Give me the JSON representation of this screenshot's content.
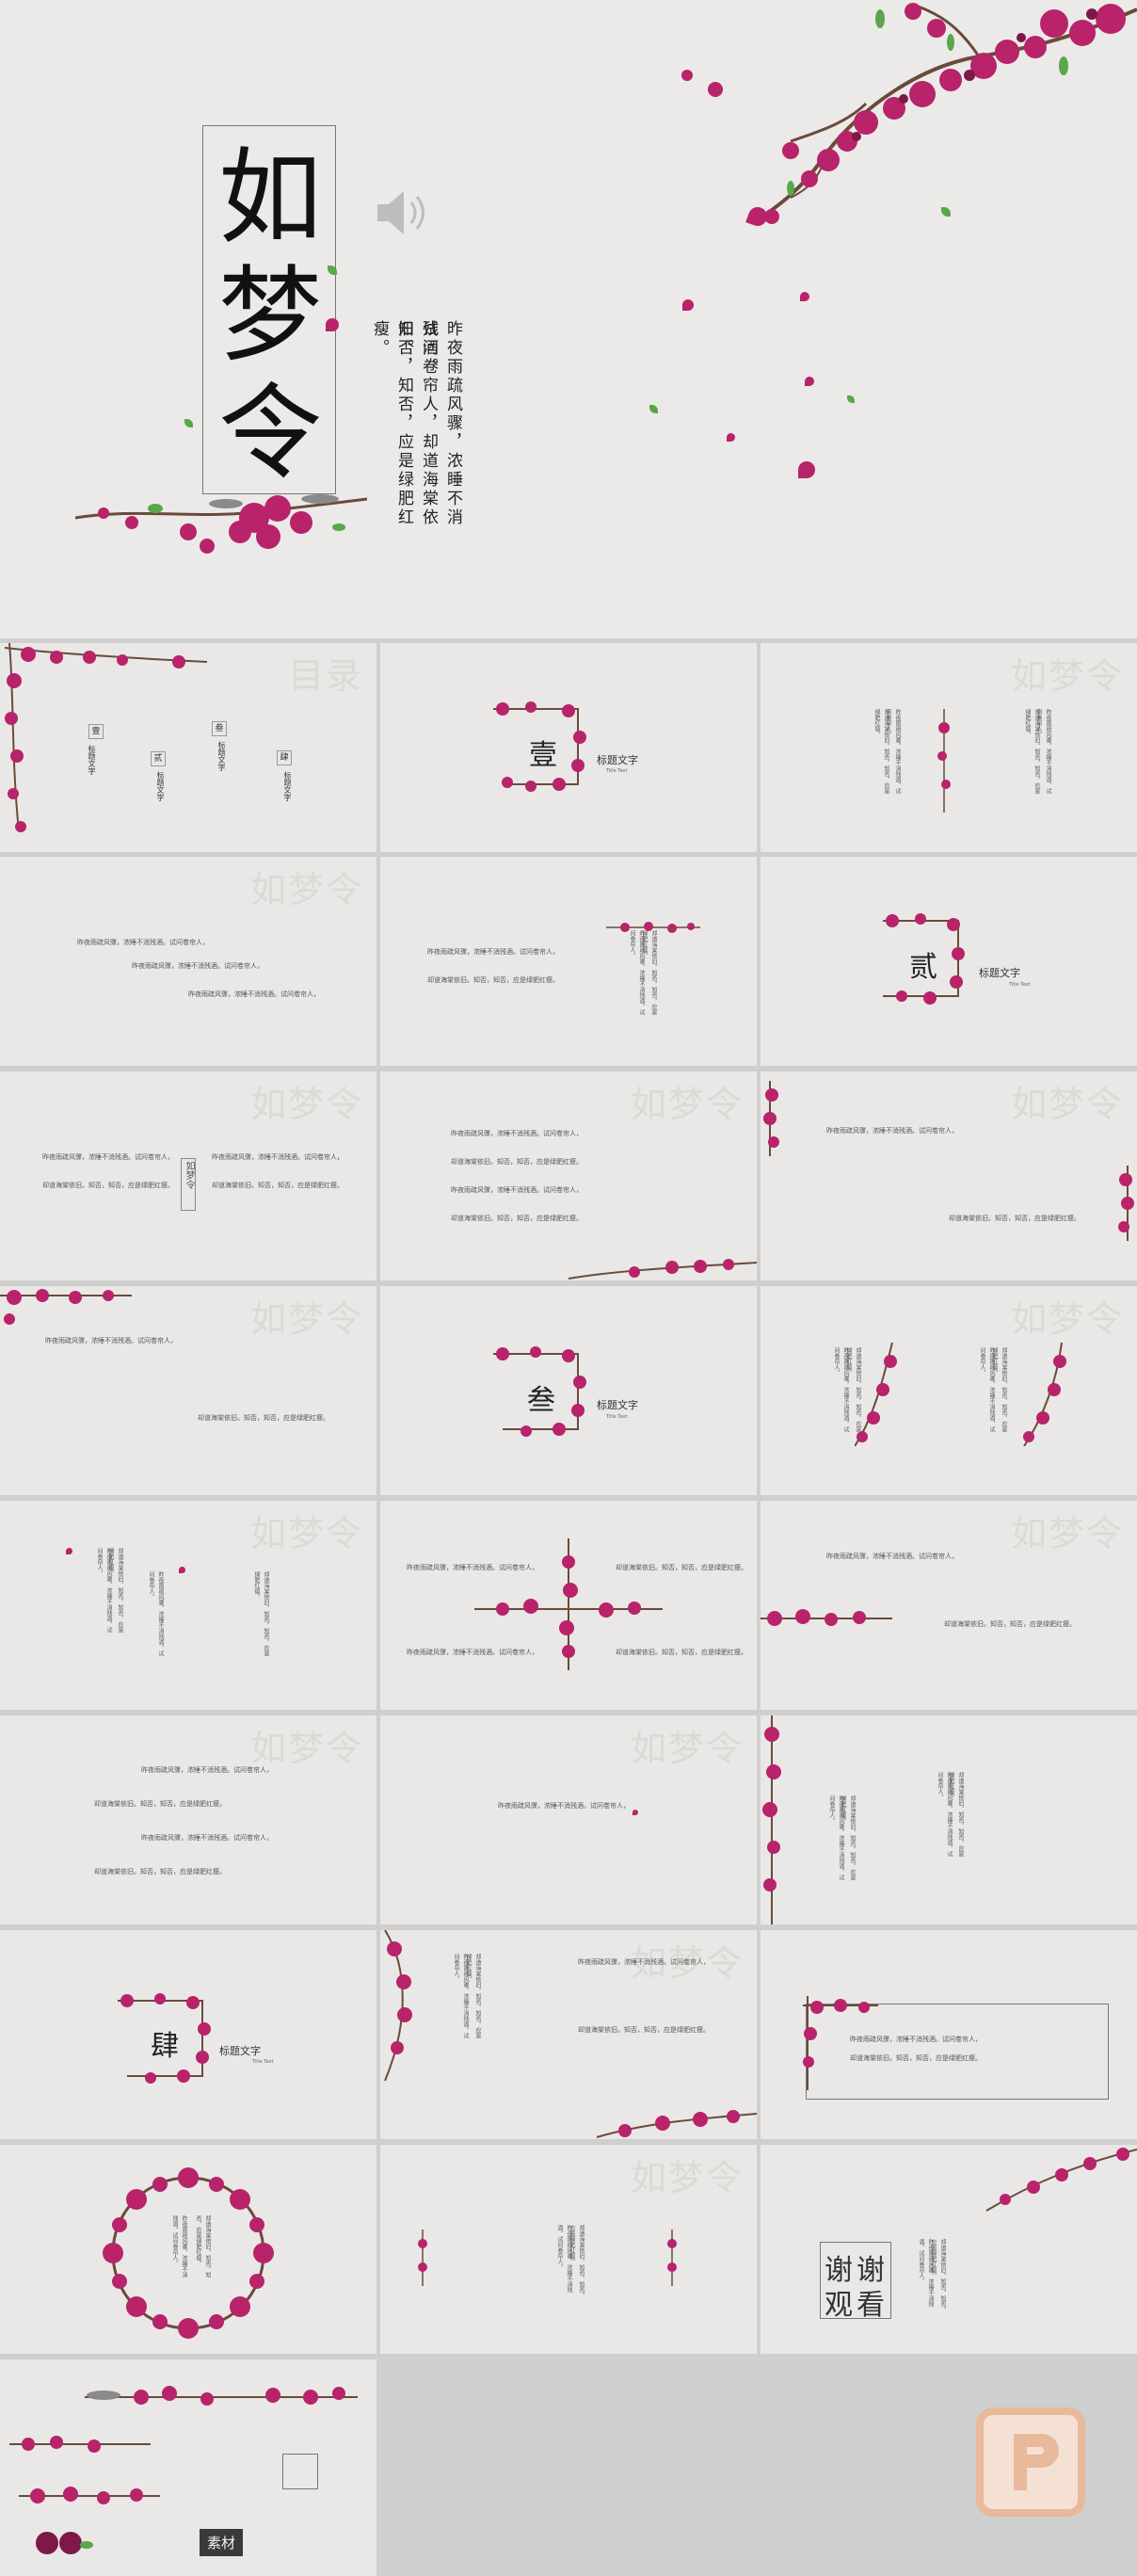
{
  "hero": {
    "title_chars": [
      "如",
      "梦",
      "令"
    ],
    "poem_lines": [
      "昨夜雨疏风骤，浓睡不消残酒。",
      "试问卷帘人，却道海棠依旧。",
      "知否，知否，应是绿肥红瘦。"
    ],
    "sound_icon": "speaker-icon"
  },
  "common": {
    "watermark": "如梦令",
    "toc_watermark": "目录",
    "title_text": "标题文字",
    "title_en": "Title Text",
    "body_text_a": "昨夜雨疏风骤，浓睡不消残酒。试问卷帘人，",
    "body_text_b": "却道海棠依旧。知否，知否，应是绿肥红瘦。"
  },
  "toc": {
    "items": [
      {
        "num": "壹",
        "label": "标题文字"
      },
      {
        "num": "贰",
        "label": "标题文字"
      },
      {
        "num": "叁",
        "label": "标题文字"
      },
      {
        "num": "肆",
        "label": "标题文字"
      }
    ]
  },
  "sections": [
    {
      "num": "壹"
    },
    {
      "num": "贰"
    },
    {
      "num": "叁"
    },
    {
      "num": "肆"
    }
  ],
  "small_title": "如梦令",
  "thanks": {
    "chars": [
      "谢",
      "谢",
      "观",
      "看"
    ]
  },
  "materials_badge": "素材",
  "colors": {
    "blossom": "#b8236a",
    "blossom_dark": "#7e1849",
    "branch": "#6b4a3a",
    "leaf": "#5aa64a",
    "slide_bg": "#e9e8e6",
    "page_bg": "#cfcfcf",
    "logo": "#e8b99a"
  }
}
